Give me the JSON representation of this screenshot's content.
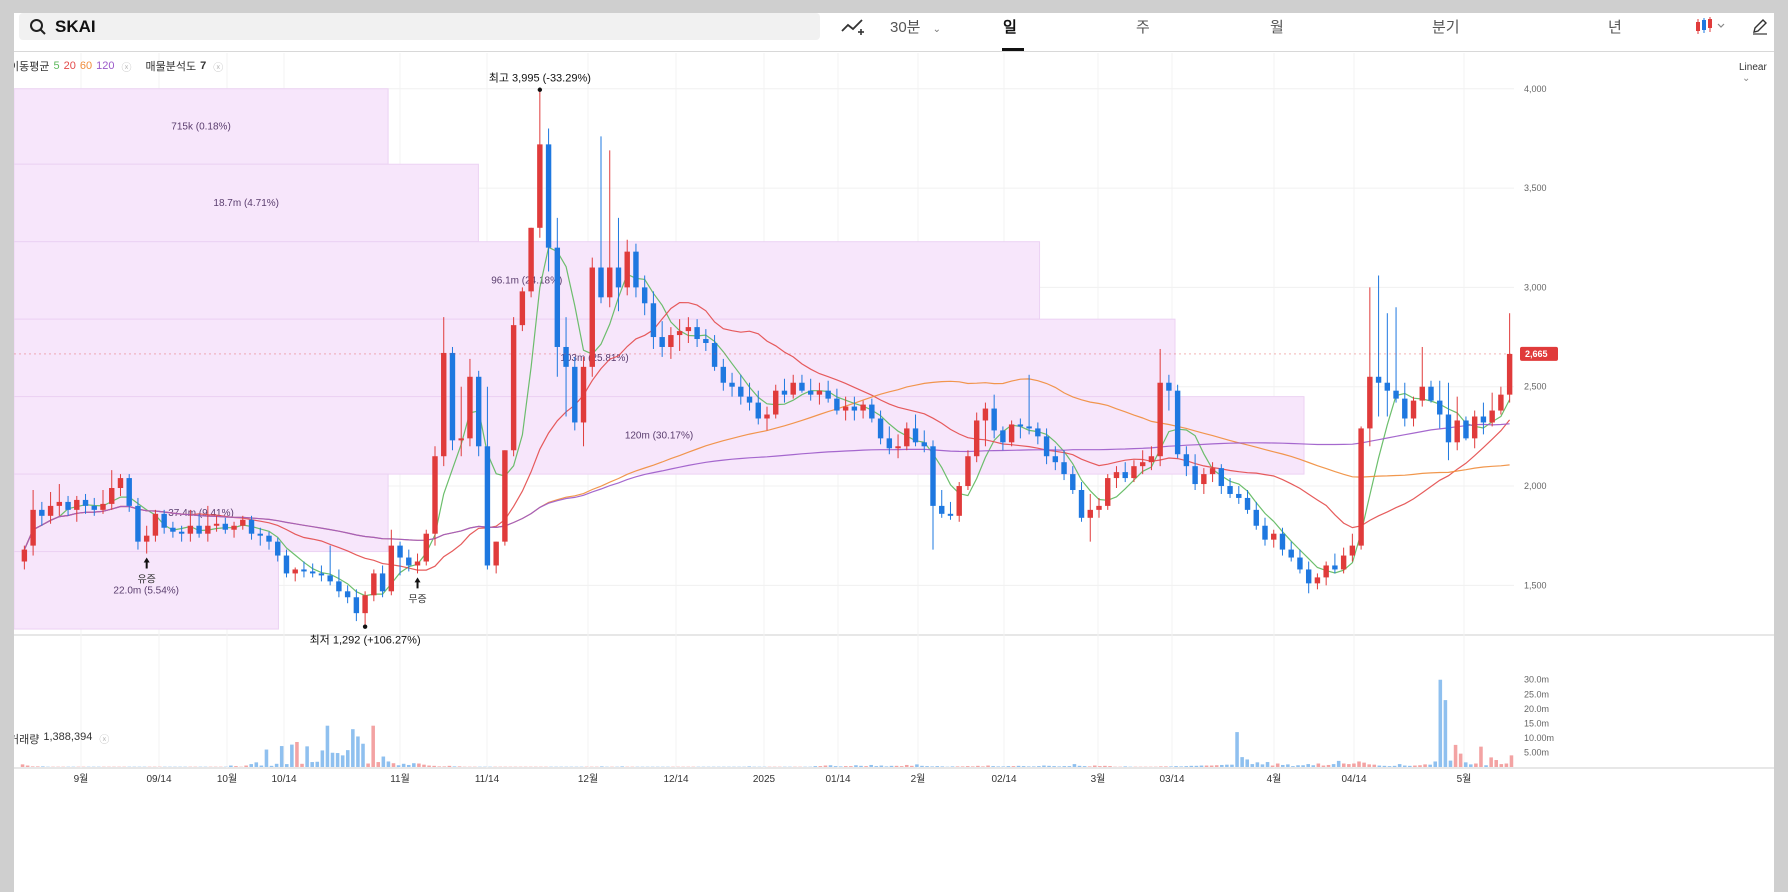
{
  "search": {
    "ticker": "SKAI"
  },
  "toolbar": {
    "interval_label": "30분",
    "periods": [
      "일",
      "주",
      "월",
      "분기",
      "년"
    ],
    "active_period": "일",
    "scale_label": "Linear"
  },
  "legend": {
    "ma_label": "이동평균",
    "ma_periods": [
      "5",
      "20",
      "60",
      "120"
    ],
    "profile_label": "매물분석도",
    "profile_value": "7"
  },
  "volume_legend": {
    "label": "거래량",
    "value": "1,388,394"
  },
  "colors": {
    "up": "#e03b3b",
    "down": "#1e78e0",
    "up_vol": "#f3a3a3",
    "down_vol": "#8fc0ef",
    "ma5": "#5cb85c",
    "ma20": "#e34a4a",
    "ma60": "#f08c3a",
    "ma120": "#9b59c9",
    "profile": "#f7e6fb"
  },
  "chart_data": {
    "type": "candlestick",
    "y_ticks": [
      "4,000",
      "3,500",
      "3,000",
      "2,500",
      "2,000",
      "1,500"
    ],
    "ylim": [
      1250,
      4180
    ],
    "x_ticks": [
      "9월",
      "09/14",
      "10월",
      "10/14",
      "11월",
      "11/14",
      "12월",
      "12/14",
      "2025",
      "01/14",
      "2월",
      "02/14",
      "3월",
      "03/14",
      "4월",
      "04/14",
      "5월"
    ],
    "last_price": "2,665",
    "high_annotation": {
      "label": "최고",
      "value": "3,995",
      "pct": "(-33.29%)",
      "price": 3995
    },
    "low_annotation": {
      "label": "최저",
      "value": "1,292",
      "pct": "(+106.27%)",
      "price": 1292
    },
    "event_labels": [
      "유증",
      "무증"
    ],
    "volume_profile": [
      {
        "low": 3620,
        "high": 4000,
        "label": "715k (0.18%)",
        "frac": 0.29
      },
      {
        "low": 3230,
        "high": 3620,
        "label": "18.7m (4.71%)",
        "frac": 0.36
      },
      {
        "low": 2840,
        "high": 3230,
        "label": "96.1m (24.18%)",
        "frac": 0.795
      },
      {
        "low": 2450,
        "high": 2840,
        "label": "103m (25.81%)",
        "frac": 0.9
      },
      {
        "low": 2060,
        "high": 2450,
        "label": "120m (30.17%)",
        "frac": 1.0
      },
      {
        "low": 1670,
        "high": 2060,
        "label": "37.4m (9.41%)",
        "frac": 0.29
      },
      {
        "low": 1280,
        "high": 1670,
        "label": "22.0m (5.54%)",
        "frac": 0.205
      }
    ],
    "volume_ticks": [
      "30.0m",
      "25.0m",
      "20.0m",
      "15.0m",
      "10.00m",
      "5.00m"
    ],
    "volume_max": 33,
    "candles": [
      [
        1620,
        1700,
        1580,
        1680
      ],
      [
        1700,
        1980,
        1650,
        1880
      ],
      [
        1880,
        1920,
        1800,
        1850
      ],
      [
        1850,
        1970,
        1810,
        1900
      ],
      [
        1900,
        2010,
        1850,
        1920
      ],
      [
        1920,
        1950,
        1850,
        1880
      ],
      [
        1880,
        1950,
        1820,
        1930
      ],
      [
        1930,
        1960,
        1860,
        1900
      ],
      [
        1900,
        1940,
        1850,
        1880
      ],
      [
        1880,
        1980,
        1860,
        1910
      ],
      [
        1910,
        2080,
        1880,
        1990
      ],
      [
        1990,
        2060,
        1950,
        2040
      ],
      [
        2040,
        2060,
        1870,
        1900
      ],
      [
        1900,
        1940,
        1680,
        1720
      ],
      [
        1720,
        1800,
        1660,
        1750
      ],
      [
        1750,
        1880,
        1720,
        1860
      ],
      [
        1860,
        1880,
        1760,
        1790
      ],
      [
        1790,
        1820,
        1740,
        1770
      ],
      [
        1770,
        1800,
        1720,
        1760
      ],
      [
        1760,
        1880,
        1720,
        1800
      ],
      [
        1800,
        1860,
        1740,
        1760
      ],
      [
        1760,
        1900,
        1720,
        1800
      ],
      [
        1800,
        1850,
        1770,
        1810
      ],
      [
        1810,
        1840,
        1760,
        1780
      ],
      [
        1780,
        1820,
        1740,
        1800
      ],
      [
        1800,
        1850,
        1780,
        1830
      ],
      [
        1830,
        1850,
        1730,
        1760
      ],
      [
        1760,
        1790,
        1700,
        1750
      ],
      [
        1750,
        1770,
        1680,
        1720
      ],
      [
        1720,
        1740,
        1620,
        1650
      ],
      [
        1650,
        1680,
        1540,
        1560
      ],
      [
        1560,
        1590,
        1520,
        1580
      ],
      [
        1580,
        1620,
        1540,
        1570
      ],
      [
        1570,
        1610,
        1540,
        1560
      ],
      [
        1560,
        1600,
        1520,
        1550
      ],
      [
        1550,
        1700,
        1500,
        1520
      ],
      [
        1520,
        1580,
        1440,
        1470
      ],
      [
        1470,
        1500,
        1410,
        1440
      ],
      [
        1440,
        1480,
        1320,
        1360
      ],
      [
        1360,
        1470,
        1300,
        1450
      ],
      [
        1450,
        1580,
        1420,
        1560
      ],
      [
        1560,
        1600,
        1440,
        1470
      ],
      [
        1470,
        1780,
        1450,
        1700
      ],
      [
        1700,
        1720,
        1550,
        1640
      ],
      [
        1640,
        1680,
        1570,
        1600
      ],
      [
        1600,
        1660,
        1560,
        1620
      ],
      [
        1620,
        1780,
        1600,
        1760
      ],
      [
        1760,
        2200,
        1700,
        2150
      ],
      [
        2150,
        2850,
        2100,
        2670
      ],
      [
        2670,
        2700,
        2180,
        2230
      ],
      [
        2230,
        2500,
        2150,
        2240
      ],
      [
        2240,
        2640,
        2200,
        2550
      ],
      [
        2550,
        2580,
        2150,
        2200
      ],
      [
        2200,
        2500,
        1580,
        1600
      ],
      [
        1600,
        1720,
        1560,
        1720
      ],
      [
        1720,
        2180,
        1700,
        2180
      ],
      [
        2180,
        2850,
        2150,
        2810
      ],
      [
        2810,
        3000,
        2780,
        2980
      ],
      [
        2980,
        3300,
        2950,
        3300
      ],
      [
        3300,
        3995,
        3250,
        3720
      ],
      [
        3720,
        3800,
        3080,
        3200
      ],
      [
        3200,
        3350,
        2550,
        2700
      ],
      [
        2700,
        2850,
        2350,
        2600
      ],
      [
        2600,
        2650,
        2280,
        2320
      ],
      [
        2320,
        2650,
        2200,
        2600
      ],
      [
        2600,
        3150,
        2550,
        3100
      ],
      [
        3100,
        3760,
        2920,
        2950
      ],
      [
        2950,
        3690,
        2900,
        3100
      ],
      [
        3100,
        3350,
        2880,
        3000
      ],
      [
        3000,
        3240,
        2960,
        3180
      ],
      [
        3180,
        3220,
        2950,
        3000
      ],
      [
        3000,
        3060,
        2860,
        2920
      ],
      [
        2920,
        2980,
        2690,
        2750
      ],
      [
        2750,
        2830,
        2650,
        2700
      ],
      [
        2700,
        2800,
        2640,
        2760
      ],
      [
        2760,
        2840,
        2680,
        2780
      ],
      [
        2780,
        2850,
        2720,
        2800
      ],
      [
        2800,
        2840,
        2700,
        2740
      ],
      [
        2740,
        2790,
        2680,
        2720
      ],
      [
        2720,
        2760,
        2580,
        2600
      ],
      [
        2600,
        2640,
        2480,
        2520
      ],
      [
        2520,
        2570,
        2450,
        2500
      ],
      [
        2500,
        2560,
        2410,
        2450
      ],
      [
        2450,
        2520,
        2380,
        2420
      ],
      [
        2420,
        2480,
        2310,
        2340
      ],
      [
        2340,
        2400,
        2280,
        2360
      ],
      [
        2360,
        2510,
        2340,
        2480
      ],
      [
        2480,
        2540,
        2420,
        2460
      ],
      [
        2460,
        2560,
        2440,
        2520
      ],
      [
        2520,
        2560,
        2470,
        2480
      ],
      [
        2480,
        2540,
        2430,
        2460
      ],
      [
        2460,
        2520,
        2410,
        2480
      ],
      [
        2480,
        2530,
        2420,
        2440
      ],
      [
        2440,
        2490,
        2360,
        2380
      ],
      [
        2380,
        2450,
        2330,
        2400
      ],
      [
        2400,
        2450,
        2330,
        2380
      ],
      [
        2380,
        2430,
        2340,
        2410
      ],
      [
        2410,
        2440,
        2320,
        2340
      ],
      [
        2340,
        2380,
        2210,
        2240
      ],
      [
        2240,
        2300,
        2160,
        2190
      ],
      [
        2190,
        2260,
        2140,
        2200
      ],
      [
        2200,
        2320,
        2180,
        2290
      ],
      [
        2290,
        2360,
        2200,
        2220
      ],
      [
        2220,
        2280,
        2170,
        2200
      ],
      [
        2200,
        2230,
        1680,
        1900
      ],
      [
        1900,
        1980,
        1840,
        1860
      ],
      [
        1860,
        1920,
        1830,
        1850
      ],
      [
        1850,
        2020,
        1820,
        2000
      ],
      [
        2000,
        2180,
        1980,
        2150
      ],
      [
        2150,
        2370,
        2120,
        2330
      ],
      [
        2330,
        2420,
        2200,
        2390
      ],
      [
        2390,
        2460,
        2240,
        2280
      ],
      [
        2280,
        2300,
        2180,
        2220
      ],
      [
        2220,
        2330,
        2200,
        2310
      ],
      [
        2310,
        2340,
        2240,
        2300
      ],
      [
        2300,
        2560,
        2260,
        2290
      ],
      [
        2290,
        2320,
        2210,
        2250
      ],
      [
        2250,
        2290,
        2110,
        2150
      ],
      [
        2150,
        2200,
        2080,
        2120
      ],
      [
        2120,
        2180,
        2030,
        2060
      ],
      [
        2060,
        2100,
        1960,
        1980
      ],
      [
        1980,
        2020,
        1820,
        1840
      ],
      [
        1840,
        1960,
        1720,
        1880
      ],
      [
        1880,
        1940,
        1840,
        1900
      ],
      [
        1900,
        2060,
        1880,
        2040
      ],
      [
        2040,
        2100,
        1990,
        2070
      ],
      [
        2070,
        2120,
        2020,
        2040
      ],
      [
        2040,
        2130,
        2020,
        2100
      ],
      [
        2100,
        2180,
        2060,
        2120
      ],
      [
        2120,
        2200,
        2080,
        2150
      ],
      [
        2150,
        2690,
        2100,
        2520
      ],
      [
        2520,
        2560,
        2380,
        2480
      ],
      [
        2480,
        2510,
        2140,
        2160
      ],
      [
        2160,
        2200,
        2050,
        2100
      ],
      [
        2100,
        2160,
        1980,
        2010
      ],
      [
        2010,
        2090,
        1960,
        2060
      ],
      [
        2060,
        2120,
        2020,
        2090
      ],
      [
        2090,
        2110,
        1960,
        2000
      ],
      [
        2000,
        2040,
        1940,
        1960
      ],
      [
        1960,
        2000,
        1910,
        1940
      ],
      [
        1940,
        1980,
        1860,
        1880
      ],
      [
        1880,
        1920,
        1780,
        1800
      ],
      [
        1800,
        1840,
        1700,
        1730
      ],
      [
        1730,
        1780,
        1690,
        1760
      ],
      [
        1760,
        1790,
        1650,
        1680
      ],
      [
        1680,
        1720,
        1620,
        1640
      ],
      [
        1640,
        1680,
        1560,
        1580
      ],
      [
        1580,
        1620,
        1460,
        1510
      ],
      [
        1510,
        1560,
        1480,
        1540
      ],
      [
        1540,
        1620,
        1500,
        1600
      ],
      [
        1600,
        1660,
        1560,
        1580
      ],
      [
        1580,
        1690,
        1560,
        1650
      ],
      [
        1650,
        1760,
        1620,
        1700
      ],
      [
        1700,
        2300,
        1680,
        2290
      ],
      [
        2290,
        3000,
        2200,
        2550
      ],
      [
        2550,
        3060,
        2350,
        2520
      ],
      [
        2520,
        2870,
        2350,
        2480
      ],
      [
        2480,
        2900,
        2420,
        2440
      ],
      [
        2440,
        2520,
        2300,
        2340
      ],
      [
        2340,
        2450,
        2300,
        2430
      ],
      [
        2430,
        2700,
        2400,
        2500
      ],
      [
        2500,
        2530,
        2420,
        2430
      ],
      [
        2430,
        2530,
        2290,
        2360
      ],
      [
        2360,
        2520,
        2130,
        2220
      ],
      [
        2220,
        2450,
        2180,
        2330
      ],
      [
        2330,
        2350,
        2230,
        2240
      ],
      [
        2240,
        2380,
        2190,
        2350
      ],
      [
        2350,
        2420,
        2260,
        2320
      ],
      [
        2320,
        2470,
        2300,
        2380
      ],
      [
        2380,
        2500,
        2360,
        2460
      ],
      [
        2460,
        2870,
        2420,
        2665
      ]
    ],
    "volumes": [
      0.9,
      0.5,
      0.2,
      0.2,
      0.2,
      0.1,
      0.1,
      0.1,
      0.1,
      0.1,
      0.1,
      0.1,
      0.1,
      0.1,
      0.1,
      0.1,
      0.1,
      0.1,
      0.1,
      0.1,
      0.1,
      0.1,
      0.1,
      0.1,
      0.1,
      0.1,
      0.1,
      0.1,
      0.1,
      0.1,
      0.1,
      0.1,
      0.1,
      0.1,
      0.1,
      0.1,
      0.1,
      0.1,
      0.1,
      0.1,
      0.1,
      0.5,
      0.3,
      0.1,
      0.5,
      1.0,
      1.6,
      0.5,
      6.0,
      0.4,
      1.1,
      7.2,
      1.0,
      7.7,
      8.6,
      1.1,
      7.1,
      1.7,
      1.8,
      5.7,
      14.2,
      4.9,
      4.8,
      4.0,
      5.8,
      13.0,
      10.5,
      8.0,
      1.2,
      14.2,
      1.7,
      3.6,
      1.9,
      1.3,
      0.6,
      1.1,
      0.7,
      1.3,
      1.2,
      0.8,
      0.5,
      0.4,
      0.2,
      0.2,
      0.4,
      0.2,
      0.2,
      0.1,
      0.1,
      0.1,
      0.1,
      0.1,
      0.1,
      0.1,
      0.1,
      0.1,
      0.1,
      0.1,
      0.1,
      0.1,
      0.1,
      0.1,
      0.1,
      0.1,
      0.1,
      0.1,
      0.1,
      0.1,
      0.1,
      0.1,
      0.1,
      0.1,
      0.1,
      0.1,
      0.2,
      0.1,
      0.1,
      0.1,
      0.2,
      0.1,
      0.1,
      0.1,
      0.1,
      0.1,
      0.1,
      0.1,
      0.1,
      0.1,
      0.1,
      0.1,
      0.1,
      0.1,
      0.1,
      0.1,
      0.1,
      0.1,
      0.1,
      0.1,
      0.1,
      0.1,
      0.1,
      0.1,
      0.1,
      0.2,
      0.1,
      0.1,
      0.1,
      0.1,
      0.1,
      0.1,
      0.1,
      0.1,
      0.1,
      0.1,
      0.1,
      0.1,
      0.3,
      0.3,
      0.5,
      0.6,
      0.3,
      0.2,
      0.3,
      0.3,
      0.6,
      0.4,
      0.3,
      0.7,
      0.3,
      0.5,
      0.2,
      0.4,
      0.4,
      0.3,
      0.7,
      0.4,
      0.9,
      0.4,
      0.3,
      0.2,
      0.3,
      0.2,
      0.1,
      0.2,
      0.2,
      0.2,
      0.3,
      0.2,
      0.4,
      0.2,
      0.5,
      0.3,
      0.2,
      0.2,
      0.3,
      0.3,
      0.4,
      0.3,
      0.2,
      0.2,
      0.3,
      0.5,
      0.4,
      0.3,
      0.2,
      0.3,
      0.3,
      1.0,
      0.4,
      0.3,
      0.2,
      0.5,
      0.3,
      0.4,
      0.3,
      0.1,
      0.1,
      0.2,
      0.1,
      0.1,
      0.1,
      0.1,
      0.1,
      0.1,
      0.2,
      0.2,
      0.2,
      0.3,
      0.2,
      0.3,
      0.4,
      0.4,
      0.5,
      0.5,
      0.5,
      0.6,
      0.7,
      0.8,
      0.8,
      12.0,
      3.4,
      2.6,
      1.0,
      1.6,
      0.9,
      1.7,
      0.5,
      1.2,
      0.7,
      0.9,
      0.3,
      0.6,
      0.6,
      1.0,
      0.6,
      1.2,
      0.5,
      0.7,
      1.0,
      2.1,
      1.2,
      1.0,
      1.2,
      1.9,
      1.5,
      0.9,
      0.8,
      0.5,
      0.4,
      0.3,
      0.4,
      1.0,
      0.5,
      0.4,
      0.5,
      0.6,
      0.9,
      0.8,
      1.9,
      30.0,
      23.0,
      2.2,
      7.6,
      4.6,
      1.6,
      0.9,
      1.2,
      7.0,
      0.6,
      3.3,
      2.4,
      1.0,
      1.2,
      4.0
    ]
  }
}
